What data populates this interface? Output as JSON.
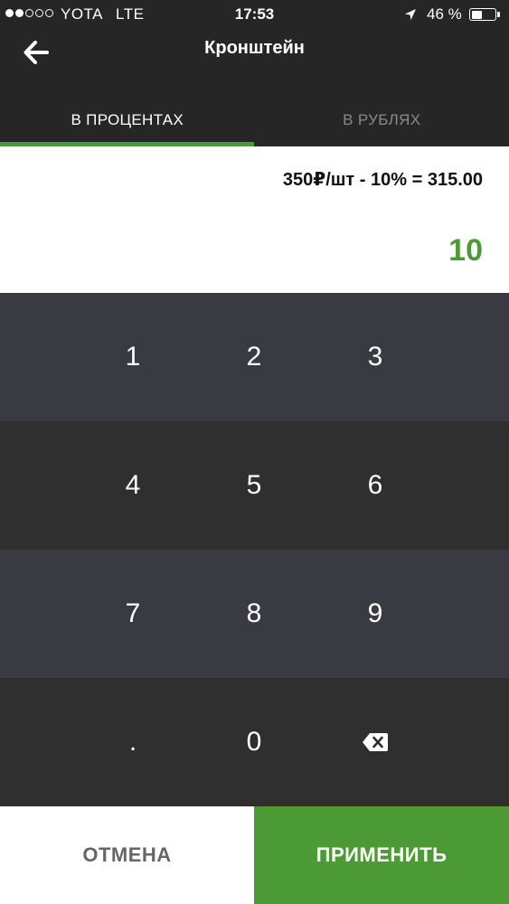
{
  "status_bar": {
    "carrier": "YOTA",
    "network": "LTE",
    "time": "17:53",
    "battery_text": "46 %",
    "battery_level": 0.46,
    "signal_bars": 2,
    "location_icon": "location-arrow-icon",
    "battery_icon": "battery-icon"
  },
  "header": {
    "title": "Кронштейн",
    "back_icon": "arrow-left-icon"
  },
  "tabs": [
    {
      "label": "В ПРОЦЕНТАХ",
      "active": true
    },
    {
      "label": "В РУБЛЯХ",
      "active": false
    }
  ],
  "discount": {
    "formula": "350₽/шт - 10% = 315.00",
    "entered_value": "10"
  },
  "keypad": {
    "keys": [
      "1",
      "2",
      "3",
      "4",
      "5",
      "6",
      "7",
      "8",
      "9",
      ".",
      "0"
    ],
    "backspace_icon": "backspace-icon"
  },
  "actions": {
    "cancel_label": "ОТМЕНА",
    "apply_label": "ПРИМЕНИТЬ"
  },
  "colors": {
    "accent": "#4c9a35",
    "header_bg": "#262626",
    "key_row_light": "#3a3a42",
    "key_row_dark": "#2f2f2f"
  }
}
